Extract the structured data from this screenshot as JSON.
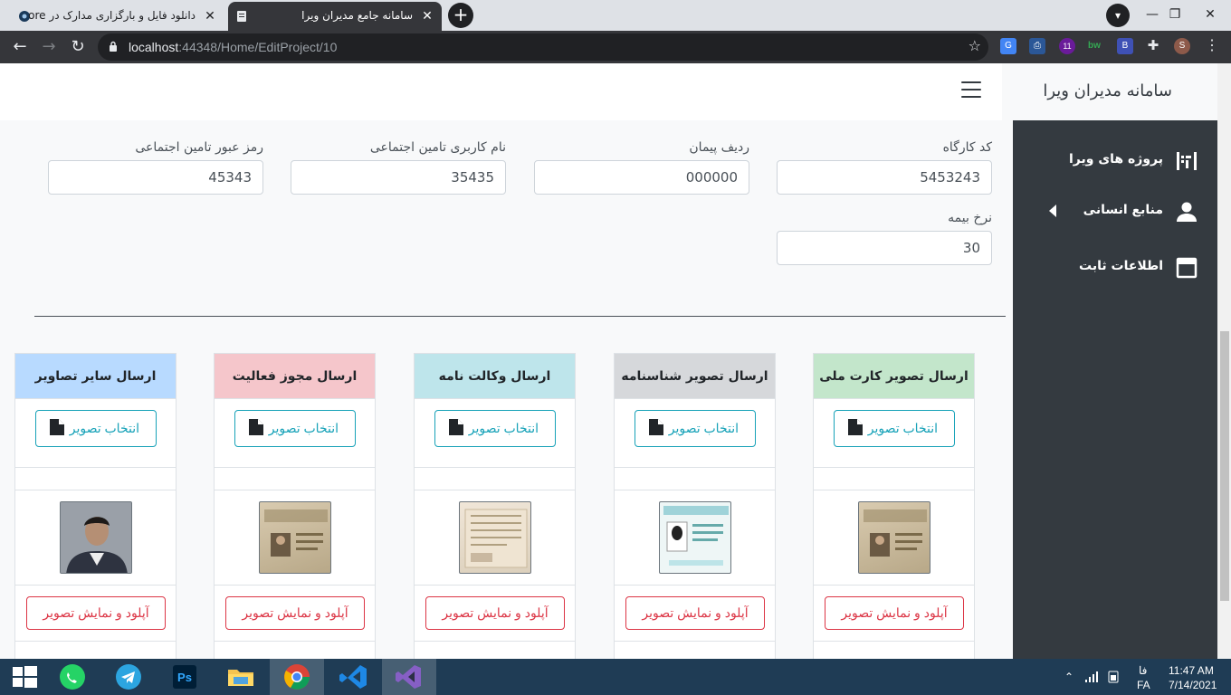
{
  "browser": {
    "tabs": [
      {
        "title": "دانلود فایل و بارگزاری مدارک در ore",
        "active": false
      },
      {
        "title": "سامانه جامع مدیران ویرا",
        "active": true
      }
    ],
    "new_tab": "+",
    "url_host": "localhost",
    "url_rest": ":44348/Home/EditProject/10",
    "profile_initial": "S",
    "ext_badge": "11",
    "ext_bw": "bw",
    "ext_b": "B"
  },
  "app": {
    "brand": "سامانه مدیران ویرا",
    "sidebar": {
      "items": [
        {
          "label": "پروژه های ویرا",
          "icon": "project-icon"
        },
        {
          "label": "منابع انسانی",
          "icon": "user-icon"
        },
        {
          "label": "اطلاعات ثابت",
          "icon": "window-icon"
        }
      ]
    },
    "form": {
      "workshop_code": {
        "label": "کد کارگاه",
        "value": "5453243"
      },
      "contract_row": {
        "label": "ردیف پیمان",
        "value": "000000"
      },
      "ss_username": {
        "label": "نام کاربری تامین اجتماعی",
        "value": "35435"
      },
      "ss_password": {
        "label": "رمز عبور تامین اجتماعی",
        "value": "45343"
      },
      "insurance_rate": {
        "label": "نرخ بیمه",
        "value": "30"
      }
    },
    "cards": [
      {
        "title": "ارسال تصویر کارت ملی",
        "head_color": "#c3e6cb"
      },
      {
        "title": "ارسال تصویر شناسنامه",
        "head_color": "#d6d8db"
      },
      {
        "title": "ارسال وکالت نامه",
        "head_color": "#bee5eb"
      },
      {
        "title": "ارسال مجوز فعالیت",
        "head_color": "#f5c6cb"
      },
      {
        "title": "ارسال سایر تصاویر",
        "head_color": "#b8daff"
      }
    ],
    "choose_label": "انتخاب تصویر",
    "upload_label": "آپلود و نمایش تصویر"
  },
  "taskbar": {
    "time": "11:47 AM",
    "date": "7/14/2021",
    "lang": "FA",
    "lang_short": "فا"
  }
}
